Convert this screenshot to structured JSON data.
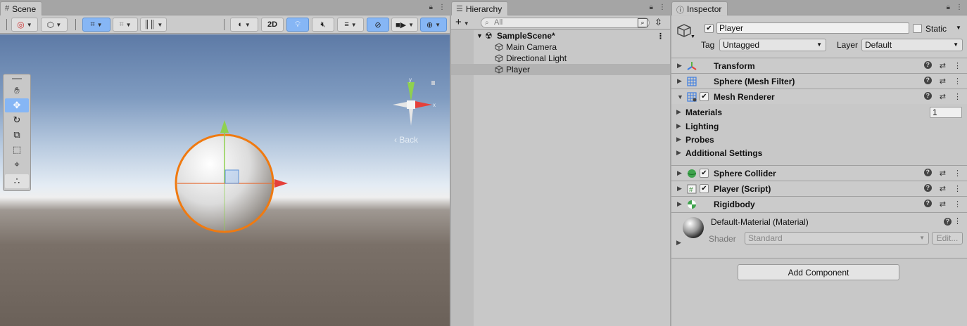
{
  "scene": {
    "tab_label": "Scene",
    "toolbar": {
      "mode_2d": "2D"
    },
    "gizmo": {
      "back_label": "Back",
      "axis_x": "x",
      "axis_y": "y"
    }
  },
  "hierarchy": {
    "tab_label": "Hierarchy",
    "search_placeholder": "All",
    "scene_name": "SampleScene*",
    "items": [
      "Main Camera",
      "Directional Light",
      "Player"
    ]
  },
  "inspector": {
    "tab_label": "Inspector",
    "object_name": "Player",
    "static_label": "Static",
    "tag_label": "Tag",
    "tag_value": "Untagged",
    "layer_label": "Layer",
    "layer_value": "Default",
    "components": {
      "transform": "Transform",
      "mesh_filter": "Sphere (Mesh Filter)",
      "mesh_renderer": "Mesh Renderer",
      "sphere_collider": "Sphere Collider",
      "player_script": "Player (Script)",
      "rigidbody": "Rigidbody"
    },
    "mesh_renderer_sections": {
      "materials": "Materials",
      "materials_count": "1",
      "lighting": "Lighting",
      "probes": "Probes",
      "additional": "Additional Settings"
    },
    "material": {
      "name": "Default-Material (Material)",
      "shader_label": "Shader",
      "shader_value": "Standard",
      "edit_label": "Edit..."
    },
    "add_component_label": "Add Component"
  },
  "colors": {
    "selection_blue": "#86b6f5",
    "sphere_outline": "#f07a10",
    "axis_x": "#e5403a",
    "axis_y": "#8fd14f"
  }
}
